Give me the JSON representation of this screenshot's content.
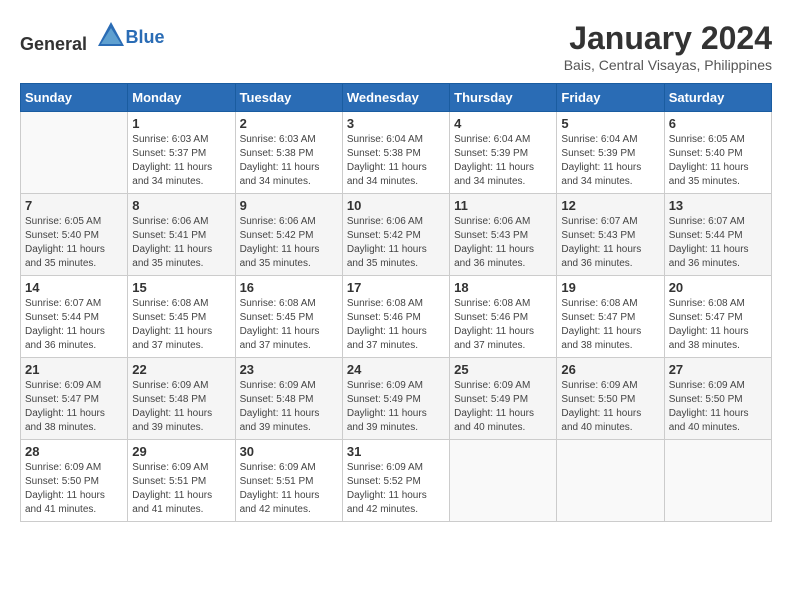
{
  "logo": {
    "text_general": "General",
    "text_blue": "Blue"
  },
  "title": "January 2024",
  "subtitle": "Bais, Central Visayas, Philippines",
  "days_of_week": [
    "Sunday",
    "Monday",
    "Tuesday",
    "Wednesday",
    "Thursday",
    "Friday",
    "Saturday"
  ],
  "weeks": [
    [
      {
        "day": "",
        "sunrise": "",
        "sunset": "",
        "daylight": ""
      },
      {
        "day": "1",
        "sunrise": "Sunrise: 6:03 AM",
        "sunset": "Sunset: 5:37 PM",
        "daylight": "Daylight: 11 hours and 34 minutes."
      },
      {
        "day": "2",
        "sunrise": "Sunrise: 6:03 AM",
        "sunset": "Sunset: 5:38 PM",
        "daylight": "Daylight: 11 hours and 34 minutes."
      },
      {
        "day": "3",
        "sunrise": "Sunrise: 6:04 AM",
        "sunset": "Sunset: 5:38 PM",
        "daylight": "Daylight: 11 hours and 34 minutes."
      },
      {
        "day": "4",
        "sunrise": "Sunrise: 6:04 AM",
        "sunset": "Sunset: 5:39 PM",
        "daylight": "Daylight: 11 hours and 34 minutes."
      },
      {
        "day": "5",
        "sunrise": "Sunrise: 6:04 AM",
        "sunset": "Sunset: 5:39 PM",
        "daylight": "Daylight: 11 hours and 34 minutes."
      },
      {
        "day": "6",
        "sunrise": "Sunrise: 6:05 AM",
        "sunset": "Sunset: 5:40 PM",
        "daylight": "Daylight: 11 hours and 35 minutes."
      }
    ],
    [
      {
        "day": "7",
        "sunrise": "Sunrise: 6:05 AM",
        "sunset": "Sunset: 5:40 PM",
        "daylight": "Daylight: 11 hours and 35 minutes."
      },
      {
        "day": "8",
        "sunrise": "Sunrise: 6:06 AM",
        "sunset": "Sunset: 5:41 PM",
        "daylight": "Daylight: 11 hours and 35 minutes."
      },
      {
        "day": "9",
        "sunrise": "Sunrise: 6:06 AM",
        "sunset": "Sunset: 5:42 PM",
        "daylight": "Daylight: 11 hours and 35 minutes."
      },
      {
        "day": "10",
        "sunrise": "Sunrise: 6:06 AM",
        "sunset": "Sunset: 5:42 PM",
        "daylight": "Daylight: 11 hours and 35 minutes."
      },
      {
        "day": "11",
        "sunrise": "Sunrise: 6:06 AM",
        "sunset": "Sunset: 5:43 PM",
        "daylight": "Daylight: 11 hours and 36 minutes."
      },
      {
        "day": "12",
        "sunrise": "Sunrise: 6:07 AM",
        "sunset": "Sunset: 5:43 PM",
        "daylight": "Daylight: 11 hours and 36 minutes."
      },
      {
        "day": "13",
        "sunrise": "Sunrise: 6:07 AM",
        "sunset": "Sunset: 5:44 PM",
        "daylight": "Daylight: 11 hours and 36 minutes."
      }
    ],
    [
      {
        "day": "14",
        "sunrise": "Sunrise: 6:07 AM",
        "sunset": "Sunset: 5:44 PM",
        "daylight": "Daylight: 11 hours and 36 minutes."
      },
      {
        "day": "15",
        "sunrise": "Sunrise: 6:08 AM",
        "sunset": "Sunset: 5:45 PM",
        "daylight": "Daylight: 11 hours and 37 minutes."
      },
      {
        "day": "16",
        "sunrise": "Sunrise: 6:08 AM",
        "sunset": "Sunset: 5:45 PM",
        "daylight": "Daylight: 11 hours and 37 minutes."
      },
      {
        "day": "17",
        "sunrise": "Sunrise: 6:08 AM",
        "sunset": "Sunset: 5:46 PM",
        "daylight": "Daylight: 11 hours and 37 minutes."
      },
      {
        "day": "18",
        "sunrise": "Sunrise: 6:08 AM",
        "sunset": "Sunset: 5:46 PM",
        "daylight": "Daylight: 11 hours and 37 minutes."
      },
      {
        "day": "19",
        "sunrise": "Sunrise: 6:08 AM",
        "sunset": "Sunset: 5:47 PM",
        "daylight": "Daylight: 11 hours and 38 minutes."
      },
      {
        "day": "20",
        "sunrise": "Sunrise: 6:08 AM",
        "sunset": "Sunset: 5:47 PM",
        "daylight": "Daylight: 11 hours and 38 minutes."
      }
    ],
    [
      {
        "day": "21",
        "sunrise": "Sunrise: 6:09 AM",
        "sunset": "Sunset: 5:47 PM",
        "daylight": "Daylight: 11 hours and 38 minutes."
      },
      {
        "day": "22",
        "sunrise": "Sunrise: 6:09 AM",
        "sunset": "Sunset: 5:48 PM",
        "daylight": "Daylight: 11 hours and 39 minutes."
      },
      {
        "day": "23",
        "sunrise": "Sunrise: 6:09 AM",
        "sunset": "Sunset: 5:48 PM",
        "daylight": "Daylight: 11 hours and 39 minutes."
      },
      {
        "day": "24",
        "sunrise": "Sunrise: 6:09 AM",
        "sunset": "Sunset: 5:49 PM",
        "daylight": "Daylight: 11 hours and 39 minutes."
      },
      {
        "day": "25",
        "sunrise": "Sunrise: 6:09 AM",
        "sunset": "Sunset: 5:49 PM",
        "daylight": "Daylight: 11 hours and 40 minutes."
      },
      {
        "day": "26",
        "sunrise": "Sunrise: 6:09 AM",
        "sunset": "Sunset: 5:50 PM",
        "daylight": "Daylight: 11 hours and 40 minutes."
      },
      {
        "day": "27",
        "sunrise": "Sunrise: 6:09 AM",
        "sunset": "Sunset: 5:50 PM",
        "daylight": "Daylight: 11 hours and 40 minutes."
      }
    ],
    [
      {
        "day": "28",
        "sunrise": "Sunrise: 6:09 AM",
        "sunset": "Sunset: 5:50 PM",
        "daylight": "Daylight: 11 hours and 41 minutes."
      },
      {
        "day": "29",
        "sunrise": "Sunrise: 6:09 AM",
        "sunset": "Sunset: 5:51 PM",
        "daylight": "Daylight: 11 hours and 41 minutes."
      },
      {
        "day": "30",
        "sunrise": "Sunrise: 6:09 AM",
        "sunset": "Sunset: 5:51 PM",
        "daylight": "Daylight: 11 hours and 42 minutes."
      },
      {
        "day": "31",
        "sunrise": "Sunrise: 6:09 AM",
        "sunset": "Sunset: 5:52 PM",
        "daylight": "Daylight: 11 hours and 42 minutes."
      },
      {
        "day": "",
        "sunrise": "",
        "sunset": "",
        "daylight": ""
      },
      {
        "day": "",
        "sunrise": "",
        "sunset": "",
        "daylight": ""
      },
      {
        "day": "",
        "sunrise": "",
        "sunset": "",
        "daylight": ""
      }
    ]
  ]
}
